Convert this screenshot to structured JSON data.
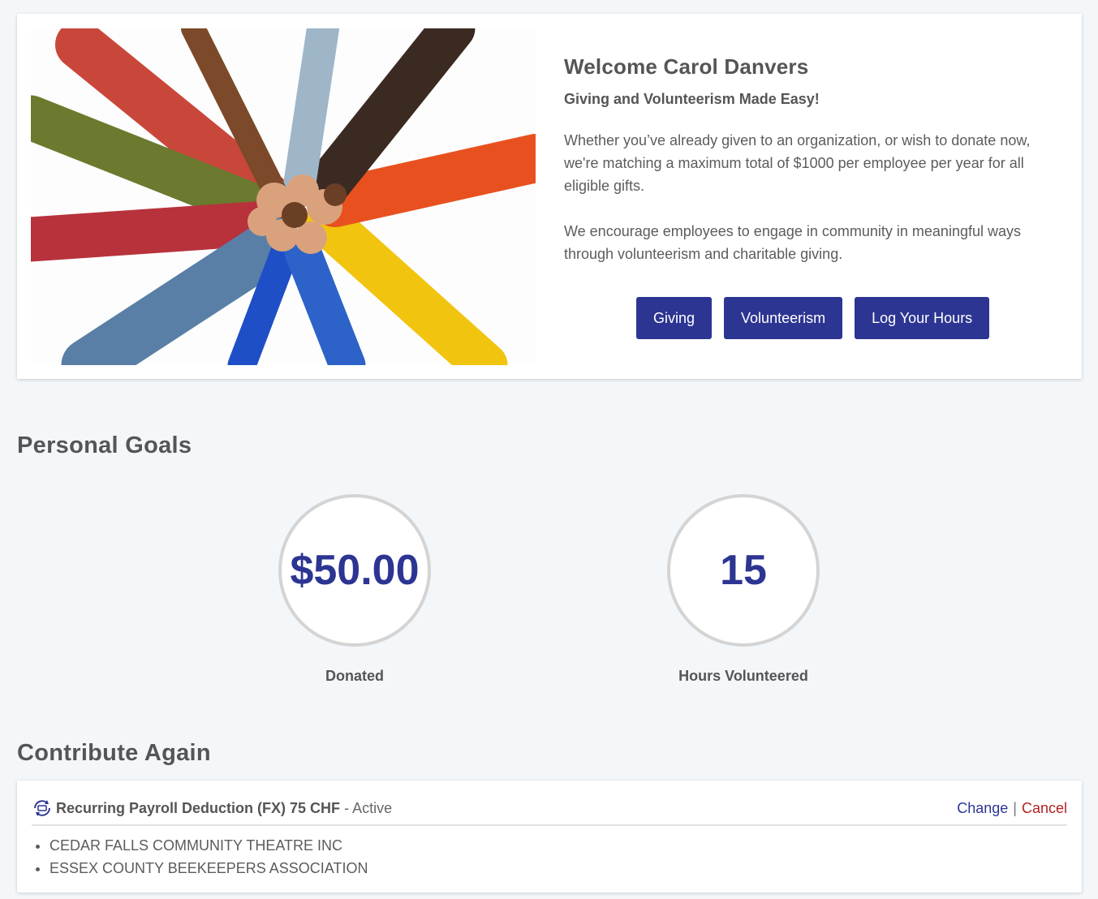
{
  "hero": {
    "image_alt": "Diverse hands joined together in a circle",
    "welcome": "Welcome Carol Danvers",
    "tagline": "Giving and Volunteerism Made Easy!",
    "paragraph1": "Whether you’ve already given to an organization, or wish to donate now, we're matching a maximum total of $1000 per employee per year for all eligible gifts.",
    "paragraph2": "We encourage employees to engage in community in meaningful ways through volunteerism and charitable giving.",
    "buttons": {
      "giving": "Giving",
      "volunteerism": "Volunteerism",
      "log_hours": "Log Your Hours"
    },
    "button_color": "#2d3592"
  },
  "personal_goals": {
    "title": "Personal Goals",
    "donated": {
      "value": "$50.00",
      "label": "Donated"
    },
    "hours": {
      "value": "15",
      "label": "Hours Volunteered"
    }
  },
  "contribute_again": {
    "title": "Contribute Again",
    "icon": "recurring-payment-icon",
    "item_title": "Recurring Payroll Deduction (FX) 75 CHF",
    "status": "- Active",
    "change_label": "Change",
    "separator": "|",
    "cancel_label": "Cancel",
    "organizations": [
      "CEDAR FALLS COMMUNITY THEATRE INC",
      "ESSEX COUNTY BEEKEEPERS ASSOCIATION"
    ]
  }
}
